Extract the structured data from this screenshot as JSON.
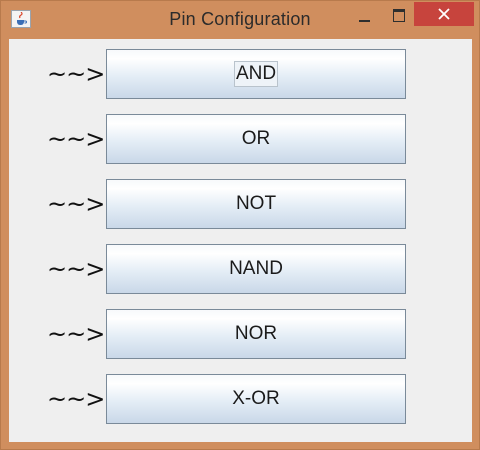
{
  "window": {
    "title": "Pin Configuration"
  },
  "icons": {
    "app": "java-cup-icon",
    "minimize": "minimize-icon",
    "maximize": "maximize-icon",
    "close": "close-icon"
  },
  "colors": {
    "frame": "#d08e5e",
    "close_button": "#c7443d",
    "client_background": "#efefef"
  },
  "rows": [
    {
      "arrow": "~~>",
      "button": "AND",
      "focused": true
    },
    {
      "arrow": "~~>",
      "button": "OR",
      "focused": false
    },
    {
      "arrow": "~~>",
      "button": "NOT",
      "focused": false
    },
    {
      "arrow": "~~>",
      "button": "NAND",
      "focused": false
    },
    {
      "arrow": "~~>",
      "button": "NOR",
      "focused": false
    },
    {
      "arrow": "~~>",
      "button": "X-OR",
      "focused": false
    }
  ]
}
